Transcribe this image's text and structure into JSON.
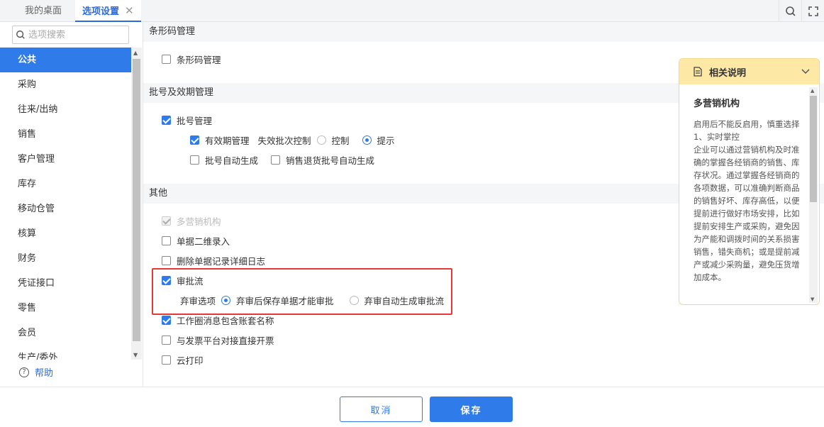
{
  "tabs": [
    {
      "label": "我的桌面"
    },
    {
      "label": "选项设置",
      "close": "✕"
    }
  ],
  "sidebar": {
    "search_placeholder": "选项搜索",
    "items": [
      {
        "label": "公共"
      },
      {
        "label": "采购"
      },
      {
        "label": "往来/出纳"
      },
      {
        "label": "销售"
      },
      {
        "label": "客户管理"
      },
      {
        "label": "库存"
      },
      {
        "label": "移动仓管"
      },
      {
        "label": "核算"
      },
      {
        "label": "财务"
      },
      {
        "label": "凭证接口"
      },
      {
        "label": "零售"
      },
      {
        "label": "会员"
      },
      {
        "label": "生产/委外"
      }
    ],
    "help_label": "帮助"
  },
  "sections": {
    "barcode": {
      "title": "条形码管理",
      "barcode_mgmt": "条形码管理"
    },
    "batch": {
      "title": "批号及效期管理",
      "batch_mgmt": "批号管理",
      "expiry_mgmt": "有效期管理",
      "expired_control": "失效批次控制",
      "opt_control": "控制",
      "opt_prompt": "提示",
      "auto_batch": "批号自动生成",
      "return_auto_batch": "销售退货批号自动生成"
    },
    "other": {
      "title": "其他",
      "multi_org": "多营销机构",
      "qr_entry": "单据二维录入",
      "delete_log": "删除单据记录详细日志",
      "approval_flow": "审批流",
      "abandon_label": "弃审选项",
      "abandon_opt1": "弃审后保存单据才能审批",
      "abandon_opt2": "弃审自动生成审批流",
      "workgroup_msg": "工作圈消息包含账套名称",
      "invoice_platform": "与发票平台对接直接开票",
      "cloud_print": "云打印"
    }
  },
  "info_panel": {
    "header": "相关说明",
    "title": "多营销机构",
    "text": "启用后不能反启用，慎重选择\n1、实时掌控\n企业可以通过营销机构及时准确的掌握各经销商的销售、库存状况。通过掌握各经销商的各项数据，可以准确判断商品的销售好坏、库存高低，以便提前进行做好市场安排，比如提前安排生产或采购，避免因为产能和调拨时间的关系损害销售，错失商机；或是提前减产或减少采购量，避免压货增加成本。"
  },
  "footer": {
    "cancel_label": "取消",
    "save_label": "保存"
  },
  "colors": {
    "accent": "#2f7bea",
    "highlight_border": "#e53935",
    "info_header_bg": "#fde8a6"
  }
}
